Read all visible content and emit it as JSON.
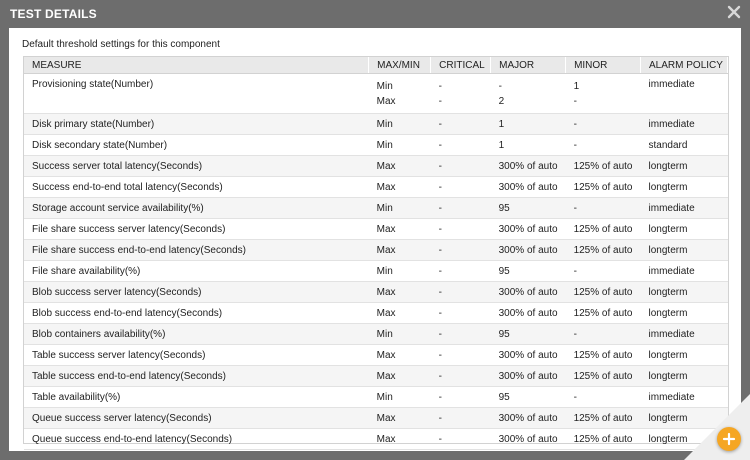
{
  "dialog": {
    "title": "TEST DETAILS",
    "subtitle": "Default threshold settings for this component"
  },
  "table": {
    "headers": [
      "MEASURE",
      "MAX/MIN",
      "CRITICAL",
      "MAJOR",
      "MINOR",
      "ALARM POLICY"
    ],
    "rows": [
      {
        "measure": "Provisioning state(Number)",
        "maxmin": [
          "Min",
          "Max"
        ],
        "critical": [
          "-",
          "-"
        ],
        "major": [
          "-",
          "2"
        ],
        "minor": [
          "1",
          "-"
        ],
        "policy": "immediate"
      },
      {
        "measure": "Disk primary state(Number)",
        "maxmin": "Min",
        "critical": "-",
        "major": "1",
        "minor": "-",
        "policy": "immediate"
      },
      {
        "measure": "Disk secondary state(Number)",
        "maxmin": "Min",
        "critical": "-",
        "major": "1",
        "minor": "-",
        "policy": "standard"
      },
      {
        "measure": "Success server total latency(Seconds)",
        "maxmin": "Max",
        "critical": "-",
        "major": "300% of auto",
        "minor": "125% of auto",
        "policy": "longterm"
      },
      {
        "measure": "Success end-to-end total latency(Seconds)",
        "maxmin": "Max",
        "critical": "-",
        "major": "300% of auto",
        "minor": "125% of auto",
        "policy": "longterm"
      },
      {
        "measure": "Storage account service availability(%)",
        "maxmin": "Min",
        "critical": "-",
        "major": "95",
        "minor": "-",
        "policy": "immediate"
      },
      {
        "measure": "File share success server latency(Seconds)",
        "maxmin": "Max",
        "critical": "-",
        "major": "300% of auto",
        "minor": "125% of auto",
        "policy": "longterm"
      },
      {
        "measure": "File share success end-to-end latency(Seconds)",
        "maxmin": "Max",
        "critical": "-",
        "major": "300% of auto",
        "minor": "125% of auto",
        "policy": "longterm"
      },
      {
        "measure": "File share availability(%)",
        "maxmin": "Min",
        "critical": "-",
        "major": "95",
        "minor": "-",
        "policy": "immediate"
      },
      {
        "measure": "Blob success server latency(Seconds)",
        "maxmin": "Max",
        "critical": "-",
        "major": "300% of auto",
        "minor": "125% of auto",
        "policy": "longterm"
      },
      {
        "measure": "Blob success end-to-end latency(Seconds)",
        "maxmin": "Max",
        "critical": "-",
        "major": "300% of auto",
        "minor": "125% of auto",
        "policy": "longterm"
      },
      {
        "measure": "Blob containers availability(%)",
        "maxmin": "Min",
        "critical": "-",
        "major": "95",
        "minor": "-",
        "policy": "immediate"
      },
      {
        "measure": "Table success server latency(Seconds)",
        "maxmin": "Max",
        "critical": "-",
        "major": "300% of auto",
        "minor": "125% of auto",
        "policy": "longterm"
      },
      {
        "measure": "Table success end-to-end latency(Seconds)",
        "maxmin": "Max",
        "critical": "-",
        "major": "300% of auto",
        "minor": "125% of auto",
        "policy": "longterm"
      },
      {
        "measure": "Table availability(%)",
        "maxmin": "Min",
        "critical": "-",
        "major": "95",
        "minor": "-",
        "policy": "immediate"
      },
      {
        "measure": "Queue success server latency(Seconds)",
        "maxmin": "Max",
        "critical": "-",
        "major": "300% of auto",
        "minor": "125% of auto",
        "policy": "longterm"
      },
      {
        "measure": "Queue success end-to-end latency(Seconds)",
        "maxmin": "Max",
        "critical": "-",
        "major": "300% of auto",
        "minor": "125% of auto",
        "policy": "longterm"
      }
    ]
  },
  "icons": {
    "close": "close-icon",
    "fab": "plus-icon"
  },
  "colors": {
    "title_bar": "#6d6d6d",
    "header_bg": "#e9e9e9",
    "alt_row": "#f5f5f5",
    "fab": "#f5a623"
  }
}
